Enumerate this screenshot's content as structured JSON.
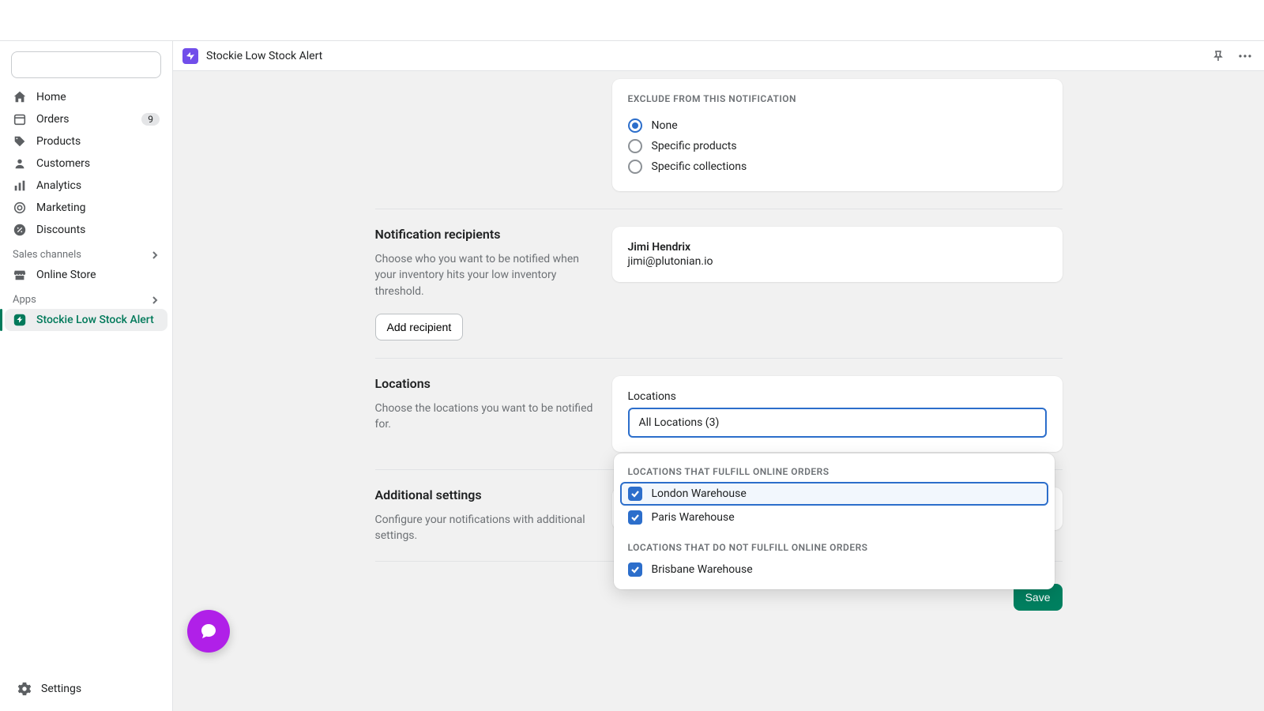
{
  "app_bar": {
    "title": "Stockie Low Stock Alert"
  },
  "sidebar": {
    "items": [
      {
        "label": "Home",
        "icon": "home"
      },
      {
        "label": "Orders",
        "icon": "orders",
        "badge": "9"
      },
      {
        "label": "Products",
        "icon": "products"
      },
      {
        "label": "Customers",
        "icon": "customers"
      },
      {
        "label": "Analytics",
        "icon": "analytics"
      },
      {
        "label": "Marketing",
        "icon": "marketing"
      },
      {
        "label": "Discounts",
        "icon": "discounts"
      }
    ],
    "sales_channels_label": "Sales channels",
    "online_store_label": "Online Store",
    "apps_label": "Apps",
    "active_app_label": "Stockie Low Stock Alert",
    "settings_label": "Settings"
  },
  "exclude": {
    "header": "EXCLUDE FROM THIS NOTIFICATION",
    "options": [
      "None",
      "Specific products",
      "Specific collections"
    ],
    "selected": "None"
  },
  "recipients": {
    "title": "Notification recipients",
    "desc": "Choose who you want to be notified when your inventory hits your low inventory threshold.",
    "add_label": "Add recipient",
    "entries": [
      {
        "name": "Jimi Hendrix",
        "email": "jimi@plutonian.io"
      }
    ]
  },
  "locations": {
    "title": "Locations",
    "desc": "Choose the locations you want to be notified for.",
    "field_label": "Locations",
    "value": "All Locations (3)",
    "dropdown": {
      "group1_header": "LOCATIONS THAT FULFILL ONLINE ORDERS",
      "group1": [
        "London Warehouse",
        "Paris Warehouse"
      ],
      "group2_header": "LOCATIONS THAT DO NOT FULFILL ONLINE ORDERS",
      "group2": [
        "Brisbane Warehouse"
      ]
    }
  },
  "additional": {
    "title": "Additional settings",
    "desc": "Configure your notifications with additional settings."
  },
  "save_label": "Save"
}
